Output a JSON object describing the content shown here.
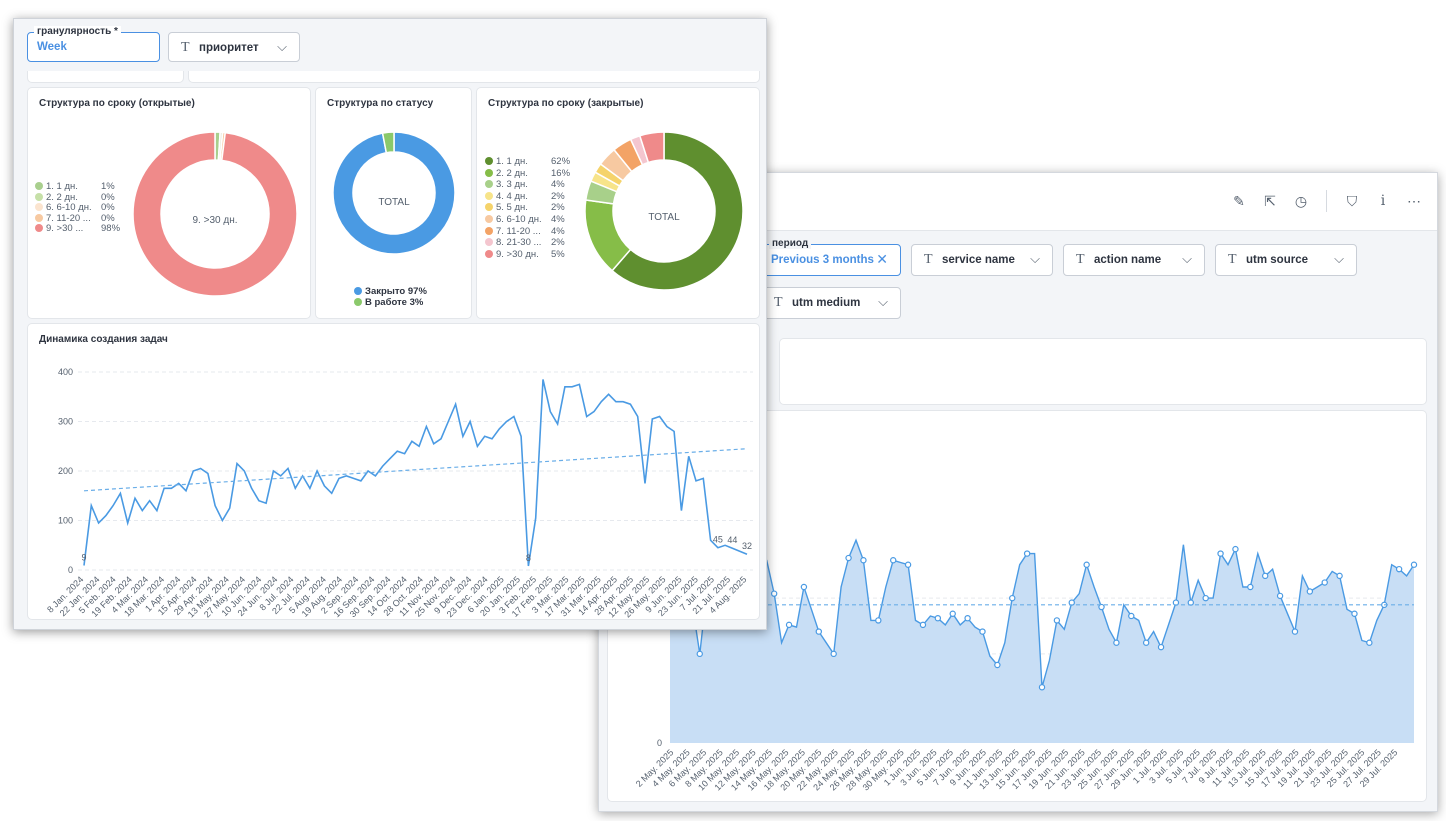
{
  "front": {
    "filter_granularity": {
      "label": "гранулярность *",
      "value": "Week"
    },
    "filter_priority": {
      "label": "приоритет"
    },
    "panel_open": {
      "title": "Структура по сроку (открытые)",
      "legend": [
        {
          "name": "1. 1 дн.",
          "pct": "1%",
          "color": "#a9cf8e"
        },
        {
          "name": "2. 2 дн.",
          "pct": "0%",
          "color": "#c6e0a8"
        },
        {
          "name": "6. 6-10 дн.",
          "pct": "0%",
          "color": "#fbe4cf"
        },
        {
          "name": "7. 11-20 ...",
          "pct": "0%",
          "color": "#f7c9a1"
        },
        {
          "name": "9. >30 ...",
          "pct": "98%",
          "color": "#ef8a8a"
        }
      ],
      "center_label": "9. >30 дн.",
      "donut": [
        1,
        0.5,
        0.5,
        98
      ],
      "donut_colors": [
        "#a9cf8e",
        "#e9e9dc",
        "#f7c9a1",
        "#ef8a8a"
      ]
    },
    "panel_status": {
      "title": "Структура по статусу",
      "center_label": "TOTAL",
      "legend": [
        {
          "name": "Закрыто 97%",
          "color": "#4a9ae3"
        },
        {
          "name": "В работе 3%",
          "color": "#8bc96b"
        }
      ],
      "donut": [
        97,
        3
      ],
      "donut_colors": [
        "#4a9ae3",
        "#8bc96b"
      ]
    },
    "panel_closed": {
      "title": "Структура по сроку (закрытые)",
      "center_label": "TOTAL",
      "legend": [
        {
          "name": "1. 1 дн.",
          "pct": "62%",
          "color": "#5f8f2f"
        },
        {
          "name": "2. 2 дн.",
          "pct": "16%",
          "color": "#86bd48"
        },
        {
          "name": "3. 3 дн.",
          "pct": "4%",
          "color": "#a8d08a"
        },
        {
          "name": "4. 4 дн.",
          "pct": "2%",
          "color": "#f7e48a"
        },
        {
          "name": "5. 5 дн.",
          "pct": "2%",
          "color": "#f5d36b"
        },
        {
          "name": "6. 6-10 дн.",
          "pct": "4%",
          "color": "#f7c9a1"
        },
        {
          "name": "7. 11-20 ...",
          "pct": "4%",
          "color": "#f3a366"
        },
        {
          "name": "8. 21-30 ...",
          "pct": "2%",
          "color": "#f4c6cf"
        },
        {
          "name": "9. >30 дн.",
          "pct": "5%",
          "color": "#ef8a8a"
        }
      ],
      "donut": [
        62,
        16,
        4,
        2,
        2,
        4,
        4,
        2,
        5
      ]
    },
    "panel_dynamics": {
      "title": "Динамика создания задач"
    }
  },
  "back": {
    "filters": {
      "period_label": "период",
      "period_value": "Previous 3 months",
      "service": "service name",
      "action": "action name",
      "utm_source": "utm source",
      "utm_medium": "utm medium"
    }
  },
  "chart_data": [
    {
      "type": "line",
      "title": "Динамика создания задач",
      "x": [
        "8 Jan. 2024",
        "22 Jan. 2024",
        "5 Feb. 2024",
        "19 Feb. 2024",
        "4 Mar. 2024",
        "18 Mar. 2024",
        "1 Apr. 2024",
        "15 Apr. 2024",
        "29 Apr. 2024",
        "13 May. 2024",
        "27 May. 2024",
        "10 Jun. 2024",
        "24 Jun. 2024",
        "8 Jul. 2024",
        "22 Jul. 2024",
        "5 Aug. 2024",
        "19 Aug. 2024",
        "2 Sep. 2024",
        "16 Sep. 2024",
        "30 Sep. 2024",
        "14 Oct. 2024",
        "28 Oct. 2024",
        "11 Nov. 2024",
        "25 Nov. 2024",
        "9 Dec. 2024",
        "23 Dec. 2024",
        "6 Jan. 2025",
        "20 Jan. 2025",
        "3 Feb. 2025",
        "17 Feb. 2025",
        "3 Mar. 2025",
        "17 Mar. 2025",
        "31 Mar. 2025",
        "14 Apr. 2025",
        "28 Apr. 2025",
        "12 May. 2025",
        "26 May. 2025",
        "9 Jun. 2025",
        "23 Jun. 2025",
        "7 Jul. 2025",
        "21 Jul. 2025",
        "4 Aug. 2025"
      ],
      "values": [
        9,
        130,
        95,
        110,
        130,
        155,
        95,
        145,
        120,
        140,
        120,
        165,
        165,
        175,
        160,
        200,
        205,
        195,
        130,
        100,
        125,
        215,
        200,
        165,
        140,
        135,
        200,
        190,
        205,
        165,
        190,
        165,
        200,
        170,
        155,
        185,
        190,
        185,
        180,
        200,
        190,
        210,
        225,
        240,
        235,
        260,
        250,
        290,
        255,
        265,
        300,
        335,
        270,
        300,
        250,
        270,
        265,
        285,
        300,
        310,
        270,
        8,
        105,
        385,
        320,
        295,
        370,
        370,
        375,
        310,
        320,
        340,
        355,
        340,
        340,
        335,
        310,
        175,
        305,
        310,
        290,
        280,
        120,
        230,
        180,
        185,
        60,
        45,
        50,
        44,
        38,
        32
      ],
      "ylim": [
        0,
        400
      ],
      "yticks": [
        0,
        100,
        200,
        300,
        400
      ],
      "visible_labels": [
        {
          "i": 0,
          "text": "9"
        },
        {
          "i": 61,
          "text": "8"
        },
        {
          "i": 87,
          "text": "45"
        },
        {
          "i": 89,
          "text": "44"
        },
        {
          "i": 91,
          "text": "32"
        }
      ],
      "trend": [
        160,
        245
      ]
    },
    {
      "type": "area",
      "x": [
        "2 May. 2025",
        "4 May. 2025",
        "6 May. 2025",
        "8 May. 2025",
        "10 May. 2025",
        "12 May. 2025",
        "14 May. 2025",
        "16 May. 2025",
        "18 May. 2025",
        "20 May. 2025",
        "22 May. 2025",
        "24 May. 2025",
        "26 May. 2025",
        "28 May. 2025",
        "30 May. 2025",
        "1 Jun. 2025",
        "3 Jun. 2025",
        "5 Jun. 2025",
        "7 Jun. 2025",
        "9 Jun. 2025",
        "11 Jun. 2025",
        "13 Jun. 2025",
        "15 Jun. 2025",
        "17 Jun. 2025",
        "19 Jun. 2025",
        "21 Jun. 2025",
        "23 Jun. 2025",
        "25 Jun. 2025",
        "27 Jun. 2025",
        "29 Jun. 2025",
        "1 Jul. 2025",
        "3 Jul. 2025",
        "5 Jul. 2025",
        "7 Jul. 2025",
        "9 Jul. 2025",
        "11 Jul. 2025",
        "13 Jul. 2025",
        "15 Jul. 2025",
        "17 Jul. 2025",
        "19 Jul. 2025",
        "21 Jul. 2025",
        "23 Jul. 2025",
        "25 Jul. 2025",
        "27 Jul. 2025",
        "29 Jul. 2025"
      ],
      "values": [
        72,
        72,
        70,
        62,
        40,
        70,
        75,
        80,
        86,
        73,
        72,
        84,
        84,
        82,
        67,
        45,
        53,
        52,
        70,
        60,
        50,
        45,
        40,
        70,
        83,
        91,
        82,
        55,
        55,
        70,
        82,
        81,
        80,
        55,
        53,
        57,
        56,
        53,
        58,
        53,
        56,
        52,
        50,
        39,
        35,
        45,
        65,
        80,
        85,
        85,
        25,
        37,
        55,
        51,
        63,
        67,
        80,
        70,
        61,
        51,
        45,
        62,
        57,
        55,
        45,
        50,
        43,
        53,
        63,
        89,
        63,
        73,
        65,
        65,
        85,
        80,
        87,
        70,
        70,
        85,
        75,
        78,
        66,
        58,
        50,
        75,
        68,
        70,
        72,
        77,
        75,
        60,
        58,
        46,
        45,
        55,
        62,
        80,
        78,
        75,
        80
      ]
    }
  ]
}
